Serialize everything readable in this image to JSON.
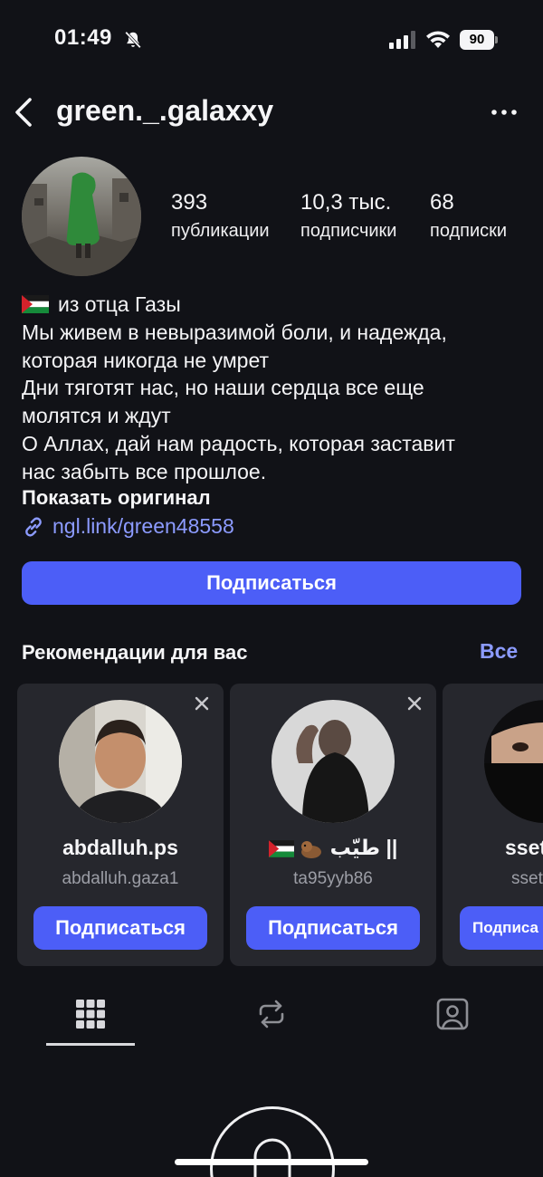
{
  "status_bar": {
    "time": "01:49",
    "battery": "90"
  },
  "header": {
    "username": "green._.galaxxy"
  },
  "stats": [
    {
      "value": "393",
      "label": "публикации"
    },
    {
      "value": "10,3 тыс.",
      "label": "подписчики"
    },
    {
      "value": "68",
      "label": "подписки"
    }
  ],
  "bio": {
    "lines": [
      "из отца Газы",
      "Мы живем в невыразимой боли, и надежда,",
      "которая никогда не умрет",
      "Дни тяготят нас, но наши сердца все еще",
      "молятся и ждут",
      "О Аллах, дай нам радость, которая заставит",
      "нас забыть все прошлое."
    ],
    "show_original": "Показать оригинал",
    "link": "ngl.link/green48558"
  },
  "follow_button": "Подписаться",
  "recommendations": {
    "title": "Рекомендации для вас",
    "see_all": "Все",
    "cards": [
      {
        "name": "abdalluh.ps",
        "subtitle": "abdalluh.gaza1",
        "button": "Подписаться"
      },
      {
        "name": "طيّب ||",
        "subtitle": "ta95yyb86",
        "button": "Подписаться"
      },
      {
        "name": "sset",
        "subtitle": "sset",
        "button": "Подписа"
      }
    ]
  },
  "colors": {
    "background": "#111217",
    "accent": "#4c5ef7",
    "link": "#8c9bff",
    "card": "#26272d"
  }
}
